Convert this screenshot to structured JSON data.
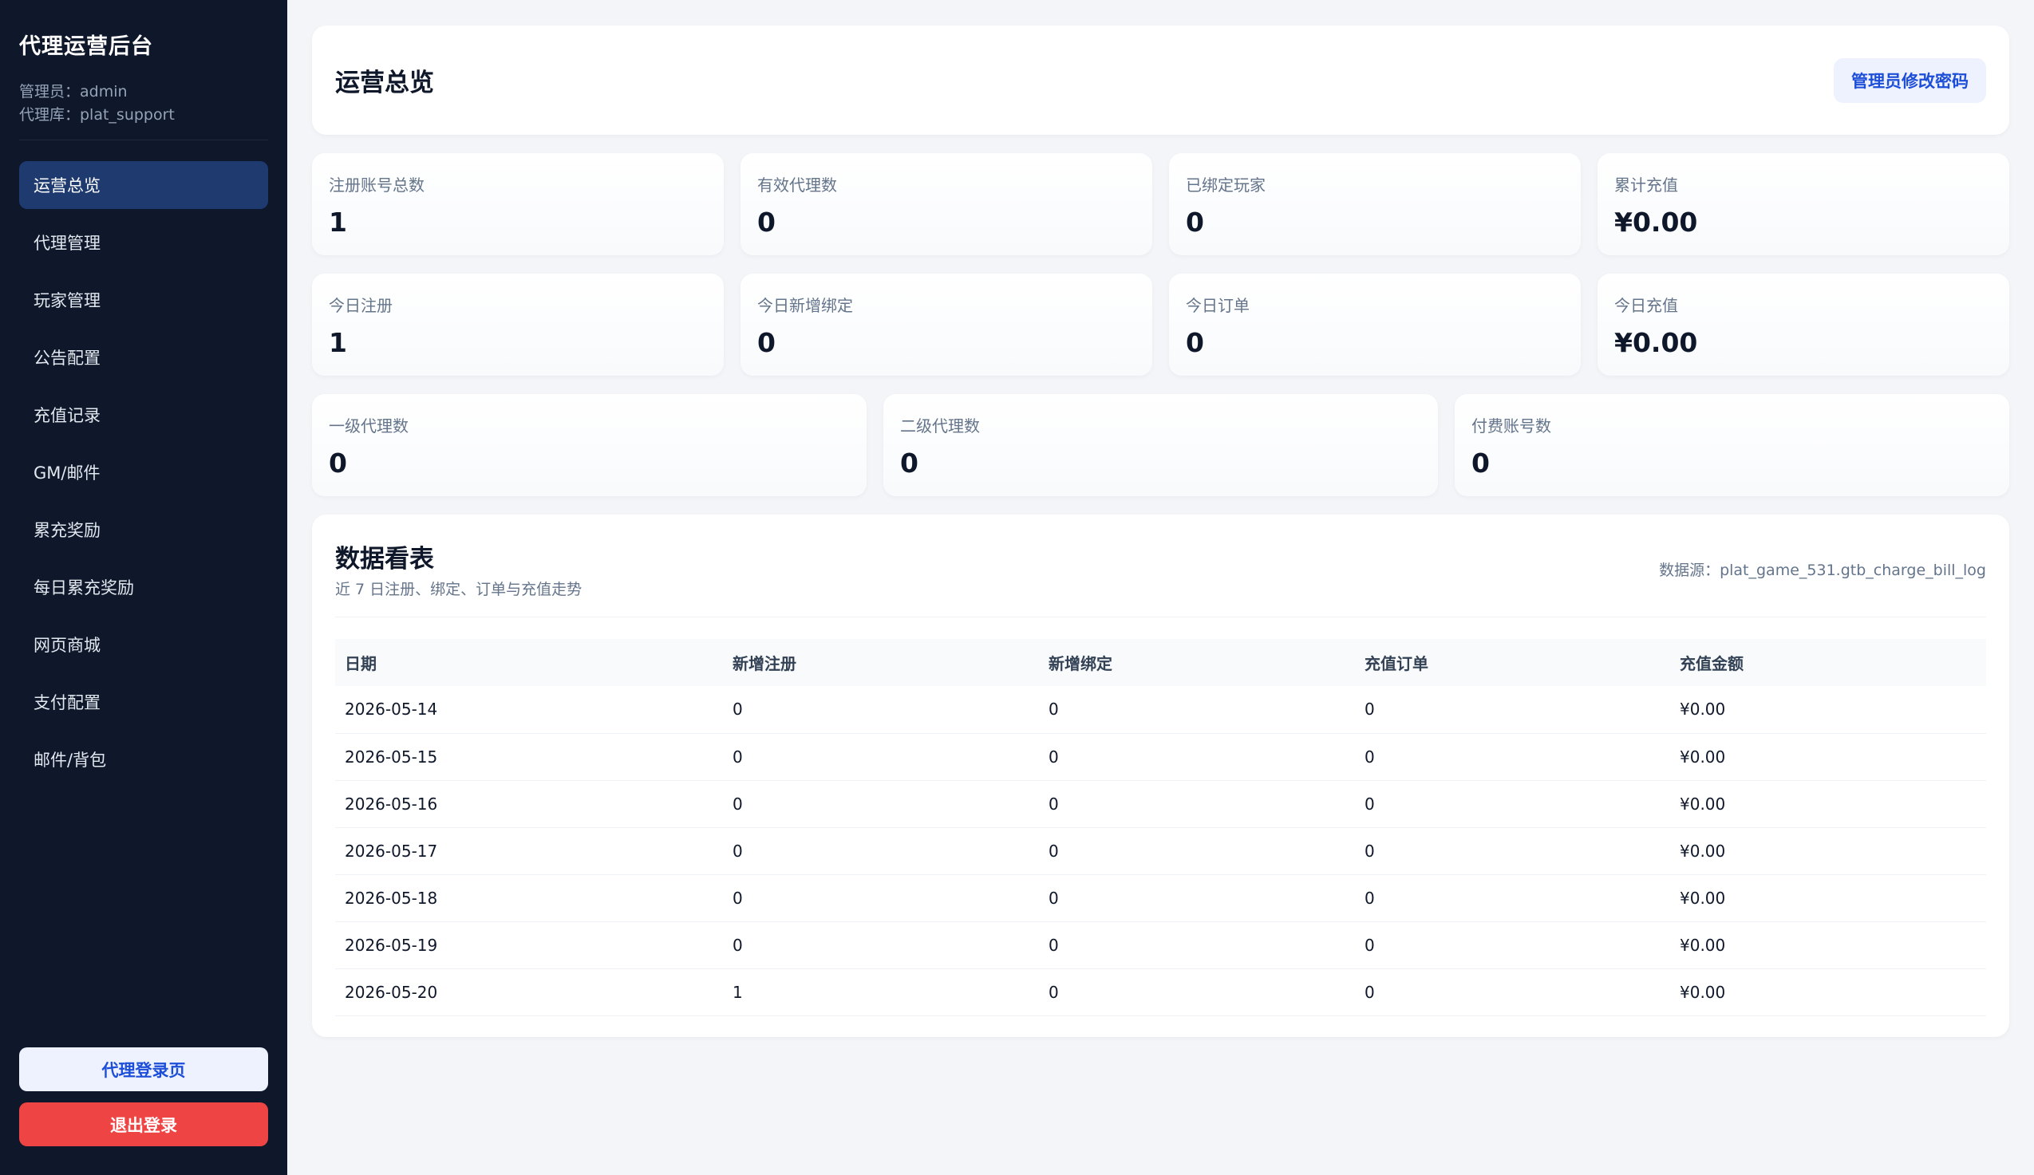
{
  "sidebar": {
    "title": "代理运营后台",
    "admin_line": "管理员：admin",
    "repo_line": "代理库：plat_support",
    "items": [
      {
        "label": "运营总览"
      },
      {
        "label": "代理管理"
      },
      {
        "label": "玩家管理"
      },
      {
        "label": "公告配置"
      },
      {
        "label": "充值记录"
      },
      {
        "label": "GM/邮件"
      },
      {
        "label": "累充奖励"
      },
      {
        "label": "每日累充奖励"
      },
      {
        "label": "网页商城"
      },
      {
        "label": "支付配置"
      },
      {
        "label": "邮件/背包"
      }
    ],
    "login_page_label": "代理登录页",
    "logout_label": "退出登录"
  },
  "header": {
    "title": "运营总览",
    "change_password_label": "管理员修改密码"
  },
  "stats": {
    "row1": [
      {
        "label": "注册账号总数",
        "value": "1"
      },
      {
        "label": "有效代理数",
        "value": "0"
      },
      {
        "label": "已绑定玩家",
        "value": "0"
      },
      {
        "label": "累计充值",
        "value": "¥0.00"
      }
    ],
    "row2": [
      {
        "label": "今日注册",
        "value": "1"
      },
      {
        "label": "今日新增绑定",
        "value": "0"
      },
      {
        "label": "今日订单",
        "value": "0"
      },
      {
        "label": "今日充值",
        "value": "¥0.00"
      }
    ],
    "row3": [
      {
        "label": "一级代理数",
        "value": "0"
      },
      {
        "label": "二级代理数",
        "value": "0"
      },
      {
        "label": "付费账号数",
        "value": "0"
      }
    ]
  },
  "board": {
    "title": "数据看表",
    "subtitle": "近 7 日注册、绑定、订单与充值走势",
    "source": "数据源：plat_game_531.gtb_charge_bill_log",
    "columns": [
      "日期",
      "新增注册",
      "新增绑定",
      "充值订单",
      "充值金额"
    ],
    "rows": [
      [
        "2026-05-14",
        "0",
        "0",
        "0",
        "¥0.00"
      ],
      [
        "2026-05-15",
        "0",
        "0",
        "0",
        "¥0.00"
      ],
      [
        "2026-05-16",
        "0",
        "0",
        "0",
        "¥0.00"
      ],
      [
        "2026-05-17",
        "0",
        "0",
        "0",
        "¥0.00"
      ],
      [
        "2026-05-18",
        "0",
        "0",
        "0",
        "¥0.00"
      ],
      [
        "2026-05-19",
        "0",
        "0",
        "0",
        "¥0.00"
      ],
      [
        "2026-05-20",
        "1",
        "0",
        "0",
        "¥0.00"
      ]
    ]
  }
}
